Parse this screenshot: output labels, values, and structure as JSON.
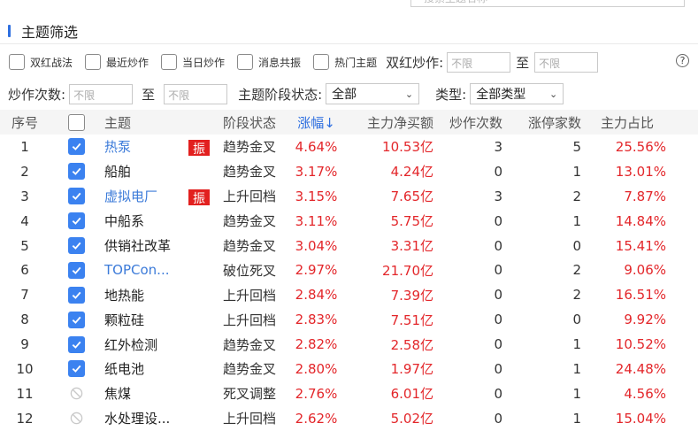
{
  "search": {
    "placeholder": "搜索主题名称"
  },
  "section_title": "主题筛选",
  "filters": {
    "checkboxes": [
      "双红战法",
      "最近炒作",
      "当日炒作",
      "消息共振",
      "热门主题"
    ],
    "double_red_label": "双红炒作:",
    "hype_count_label": "炒作次数:",
    "placeholder_unlimited": "不限",
    "to_label": "至",
    "stage_label": "主题阶段状态:",
    "stage_value": "全部",
    "type_label": "类型:",
    "type_value": "全部类型",
    "help_icon": "?"
  },
  "table": {
    "headers": {
      "index": "序号",
      "theme": "主题",
      "stage": "阶段状态",
      "change": "涨幅",
      "sort_arrow": "↓",
      "net_buy": "主力净买额",
      "hype_count": "炒作次数",
      "limit_up": "涨停家数",
      "main_ratio": "主力占比"
    },
    "badge_text": "振",
    "rows": [
      {
        "idx": "1",
        "checked": true,
        "name": "热泵",
        "link": true,
        "badge": true,
        "stage": "趋势金叉",
        "change": "4.64%",
        "net": "10.53亿",
        "count": "3",
        "limit": "5",
        "ratio": "25.56%"
      },
      {
        "idx": "2",
        "checked": true,
        "name": "船舶",
        "link": false,
        "badge": false,
        "stage": "趋势金叉",
        "change": "3.17%",
        "net": "4.24亿",
        "count": "0",
        "limit": "1",
        "ratio": "13.01%"
      },
      {
        "idx": "3",
        "checked": true,
        "name": "虚拟电厂",
        "link": true,
        "badge": true,
        "stage": "上升回档",
        "change": "3.15%",
        "net": "7.65亿",
        "count": "3",
        "limit": "2",
        "ratio": "7.87%"
      },
      {
        "idx": "4",
        "checked": true,
        "name": "中船系",
        "link": false,
        "badge": false,
        "stage": "趋势金叉",
        "change": "3.11%",
        "net": "5.75亿",
        "count": "0",
        "limit": "1",
        "ratio": "14.84%"
      },
      {
        "idx": "5",
        "checked": true,
        "name": "供销社改革",
        "link": false,
        "badge": false,
        "stage": "趋势金叉",
        "change": "3.04%",
        "net": "3.31亿",
        "count": "0",
        "limit": "0",
        "ratio": "15.41%"
      },
      {
        "idx": "6",
        "checked": true,
        "name": "TOPCon...",
        "link": true,
        "badge": false,
        "stage": "破位死叉",
        "change": "2.97%",
        "net": "21.70亿",
        "count": "0",
        "limit": "2",
        "ratio": "9.06%"
      },
      {
        "idx": "7",
        "checked": true,
        "name": "地热能",
        "link": false,
        "badge": false,
        "stage": "上升回档",
        "change": "2.84%",
        "net": "7.39亿",
        "count": "0",
        "limit": "2",
        "ratio": "16.51%"
      },
      {
        "idx": "8",
        "checked": true,
        "name": "颗粒硅",
        "link": false,
        "badge": false,
        "stage": "上升回档",
        "change": "2.83%",
        "net": "7.51亿",
        "count": "0",
        "limit": "0",
        "ratio": "9.92%"
      },
      {
        "idx": "9",
        "checked": true,
        "name": "红外检测",
        "link": false,
        "badge": false,
        "stage": "趋势金叉",
        "change": "2.82%",
        "net": "2.58亿",
        "count": "0",
        "limit": "1",
        "ratio": "10.52%"
      },
      {
        "idx": "10",
        "checked": true,
        "name": "纸电池",
        "link": false,
        "badge": false,
        "stage": "趋势金叉",
        "change": "2.80%",
        "net": "1.97亿",
        "count": "0",
        "limit": "1",
        "ratio": "24.48%"
      },
      {
        "idx": "11",
        "checked": false,
        "name": "焦煤",
        "link": false,
        "badge": false,
        "stage": "死叉调整",
        "change": "2.76%",
        "net": "6.01亿",
        "count": "0",
        "limit": "1",
        "ratio": "4.56%"
      },
      {
        "idx": "12",
        "checked": false,
        "name": "水处理设...",
        "link": false,
        "badge": false,
        "stage": "上升回档",
        "change": "2.62%",
        "net": "5.02亿",
        "count": "0",
        "limit": "1",
        "ratio": "15.04%"
      }
    ]
  },
  "colors": {
    "accent": "#3b82f0",
    "up_red": "#e3262a",
    "badge_red": "#e2201f",
    "link_blue": "#3c7bd9"
  }
}
